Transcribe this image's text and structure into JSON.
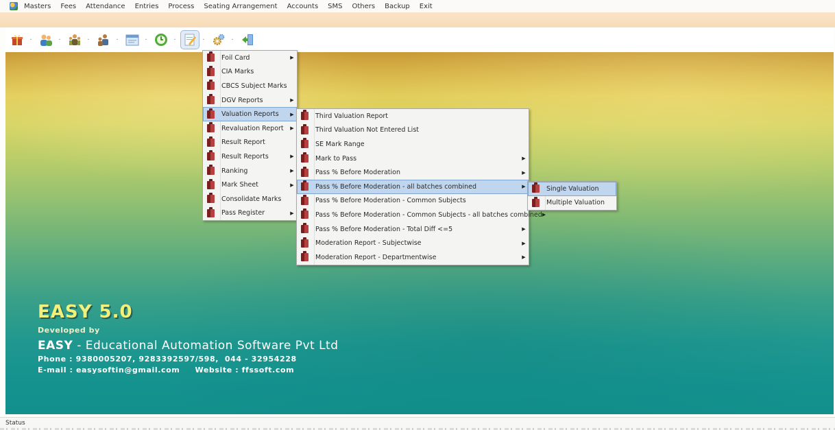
{
  "menubar": {
    "items": [
      "Masters",
      "Fees",
      "Attendance",
      "Entries",
      "Process",
      "Seating Arrangement",
      "Accounts",
      "SMS",
      "Others",
      "Backup",
      "Exit"
    ]
  },
  "toolbar": {
    "icons": [
      "gift-icon",
      "users-icon",
      "people-icon",
      "group-icon",
      "calendar-icon",
      "clock-icon",
      "notepad-icon",
      "settings-icon",
      "exit-door-icon"
    ],
    "active_index": 6
  },
  "menus": {
    "reports": [
      {
        "label": "Foil Card",
        "submenu": true
      },
      {
        "label": "CIA Marks",
        "submenu": false
      },
      {
        "label": "CBCS Subject Marks",
        "submenu": false
      },
      {
        "label": "DGV Reports",
        "submenu": true
      },
      {
        "label": "Valuation Reports",
        "submenu": true,
        "highlighted": true
      },
      {
        "label": "Revaluation Report",
        "submenu": true
      },
      {
        "label": "Result Report",
        "submenu": false
      },
      {
        "label": "Result Reports",
        "submenu": true
      },
      {
        "label": "Ranking",
        "submenu": true
      },
      {
        "label": "Mark Sheet",
        "submenu": true
      },
      {
        "label": "Consolidate Marks",
        "submenu": false
      },
      {
        "label": "Pass Register",
        "submenu": true
      }
    ],
    "valuation": [
      {
        "label": "Third Valuation Report",
        "submenu": false
      },
      {
        "label": "Third Valuation Not Entered List",
        "submenu": false
      },
      {
        "label": "SE Mark Range",
        "submenu": false
      },
      {
        "label": "Mark to Pass",
        "submenu": true
      },
      {
        "label": "Pass % Before Moderation",
        "submenu": true
      },
      {
        "label": "Pass % Before Moderation - all batches combined",
        "submenu": true,
        "highlighted": true
      },
      {
        "label": "Pass % Before Moderation - Common Subjects",
        "submenu": false
      },
      {
        "label": "Pass % Before Moderation - Common Subjects - all batches combined",
        "submenu": true
      },
      {
        "label": "Pass % Before Moderation - Total Diff <=5",
        "submenu": true
      },
      {
        "label": "Moderation Report - Subjectwise",
        "submenu": true
      },
      {
        "label": "Moderation Report - Departmentwise",
        "submenu": true
      }
    ],
    "pass_batches": [
      {
        "label": "Single Valuation",
        "submenu": false,
        "highlighted": true
      },
      {
        "label": "Multiple Valuation",
        "submenu": false
      }
    ]
  },
  "brand": {
    "title": "EASY 5.0",
    "developed_by": "Developed by",
    "company_short": "EASY",
    "company_rest": " - Educational Automation Software Pvt Ltd",
    "phone": "Phone : 9380005207, 9283392597/598,  044 - 32954228",
    "contact": "E-mail : easysoftin@gmail.com     Website : ffssoft.com"
  },
  "status": {
    "text": "Status"
  },
  "colors": {
    "menu_highlight": "#bfd6ee",
    "brand_title": "#f2f07c",
    "header_band": "#fbe3c6"
  }
}
